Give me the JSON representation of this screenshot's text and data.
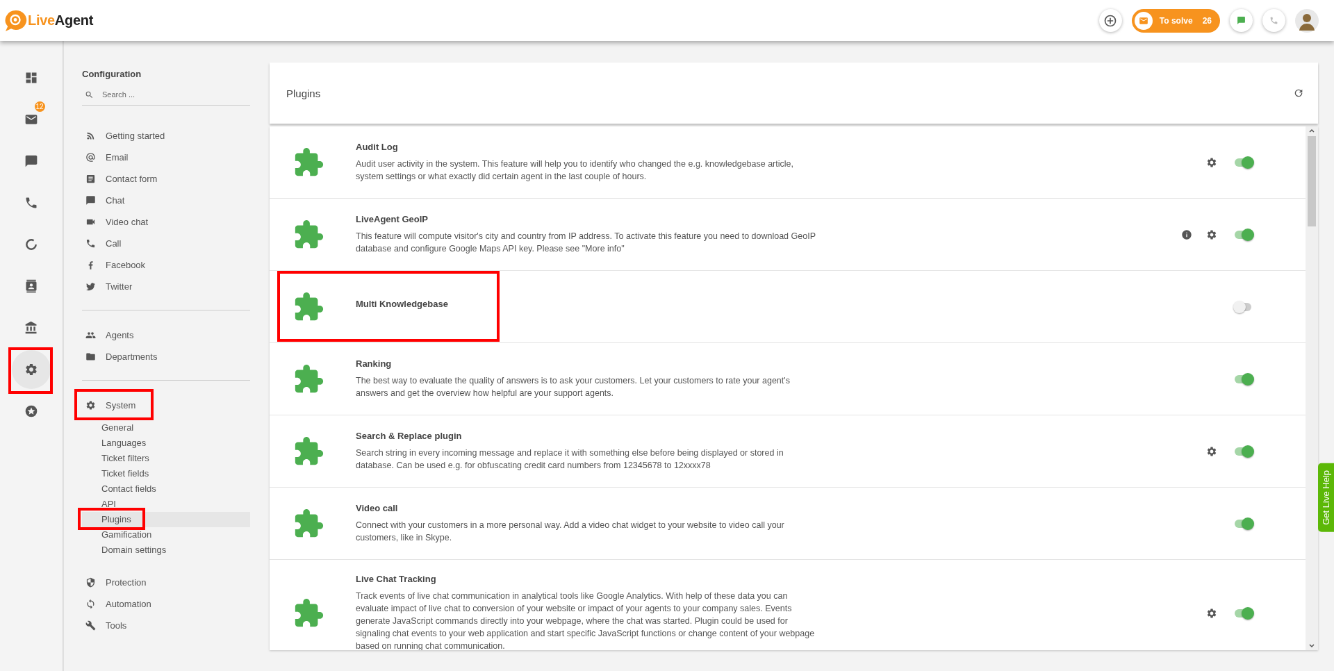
{
  "header": {
    "logo": [
      "Live",
      "Agent"
    ],
    "to_solve": {
      "label": "To solve",
      "count": "26"
    }
  },
  "rail": [
    {
      "kind": "dashboard",
      "selected": false,
      "highlighted": false
    },
    {
      "kind": "mail",
      "selected": false,
      "highlighted": false,
      "badge": "12"
    },
    {
      "kind": "chat",
      "selected": false,
      "highlighted": false
    },
    {
      "kind": "phone",
      "selected": false,
      "highlighted": false
    },
    {
      "kind": "reports",
      "selected": false,
      "highlighted": false
    },
    {
      "kind": "contacts",
      "selected": false,
      "highlighted": false
    },
    {
      "kind": "bank",
      "selected": false,
      "highlighted": false
    },
    {
      "kind": "gear",
      "selected": true,
      "highlighted": true
    },
    {
      "kind": "star",
      "selected": false,
      "highlighted": false
    }
  ],
  "configuration": {
    "title": "Configuration",
    "search": {
      "placeholder": "Search ..."
    },
    "groups": [
      [
        {
          "kind": "rss",
          "label": "Getting started",
          "highlighted": false
        },
        {
          "kind": "at",
          "label": "Email",
          "highlighted": false
        },
        {
          "kind": "form",
          "label": "Contact form",
          "highlighted": false
        },
        {
          "kind": "chat",
          "label": "Chat",
          "highlighted": false
        },
        {
          "kind": "video",
          "label": "Video chat",
          "highlighted": false
        },
        {
          "kind": "phone",
          "label": "Call",
          "highlighted": false
        },
        {
          "kind": "facebook",
          "label": "Facebook",
          "highlighted": false
        },
        {
          "kind": "twitter",
          "label": "Twitter",
          "highlighted": false
        }
      ],
      [
        {
          "kind": "people",
          "label": "Agents",
          "highlighted": false
        },
        {
          "kind": "folder",
          "label": "Departments",
          "highlighted": false
        }
      ],
      [
        {
          "kind": "gear",
          "label": "System",
          "highlighted": true,
          "children": [
            {
              "label": "General",
              "selected": false,
              "highlighted": false
            },
            {
              "label": "Languages",
              "selected": false,
              "highlighted": false
            },
            {
              "label": "Ticket filters",
              "selected": false,
              "highlighted": false
            },
            {
              "label": "Ticket fields",
              "selected": false,
              "highlighted": false
            },
            {
              "label": "Contact fields",
              "selected": false,
              "highlighted": false
            },
            {
              "label": "API",
              "selected": false,
              "highlighted": false
            },
            {
              "label": "Plugins",
              "selected": true,
              "highlighted": true
            },
            {
              "label": "Gamification",
              "selected": false,
              "highlighted": false
            },
            {
              "label": "Domain settings",
              "selected": false,
              "highlighted": false
            }
          ]
        },
        {
          "kind": "shield",
          "label": "Protection",
          "highlighted": false
        },
        {
          "kind": "sync",
          "label": "Automation",
          "highlighted": false
        },
        {
          "kind": "wrench",
          "label": "Tools",
          "highlighted": false
        }
      ]
    ]
  },
  "plugins": {
    "title": "Plugins",
    "items": [
      {
        "name": "Audit Log",
        "description": "Audit user activity in the system. This feature will help you to identify who changed the e.g. knowledgebase article, system settings or what exactly did certain agent in the last couple of hours.",
        "info": false,
        "settings": true,
        "enabled": true,
        "highlighted": false
      },
      {
        "name": "LiveAgent GeoIP",
        "description": "This feature will compute visitor's city and country from IP address. To activate this feature you need to download GeoIP database and configure Google Maps API key. Please see \"More info\"",
        "info": true,
        "settings": true,
        "enabled": true,
        "highlighted": false
      },
      {
        "name": "Multi Knowledgebase",
        "info": false,
        "settings": false,
        "enabled": false,
        "highlighted": true
      },
      {
        "name": "Ranking",
        "description": "The best way to evaluate the quality of answers is to ask your customers. Let your customers to rate your agent's answers and get the overview how helpful are your support agents.",
        "info": false,
        "settings": false,
        "enabled": true,
        "highlighted": false
      },
      {
        "name": "Search & Replace plugin",
        "description": "Search string in every incoming message and replace it with something else before being displayed or stored in database. Can be used e.g. for obfuscating credit card numbers from 12345678 to 12xxxx78",
        "info": false,
        "settings": true,
        "enabled": true,
        "highlighted": false
      },
      {
        "name": "Video call",
        "description": "Connect with your customers in a more personal way. Add a video chat widget to your website to video call your customers, like in Skype.",
        "info": false,
        "settings": false,
        "enabled": true,
        "highlighted": false
      },
      {
        "name": "Live Chat Tracking",
        "description": "Track events of live chat communication in analytical tools like Google Analytics. With help of these data you can evaluate impact of live chat to conversion of your website or impact of your agents to your company sales. Events generate JavaScript commands directly into your webpage, where the chat was started. Plugin could be used for signaling chat events to your web application and start specific JavaScript functions or change content of your webpage based on running chat communication.",
        "info": false,
        "settings": true,
        "enabled": true,
        "highlighted": false
      }
    ]
  },
  "help_tab": {
    "label": "Get Live Help"
  }
}
